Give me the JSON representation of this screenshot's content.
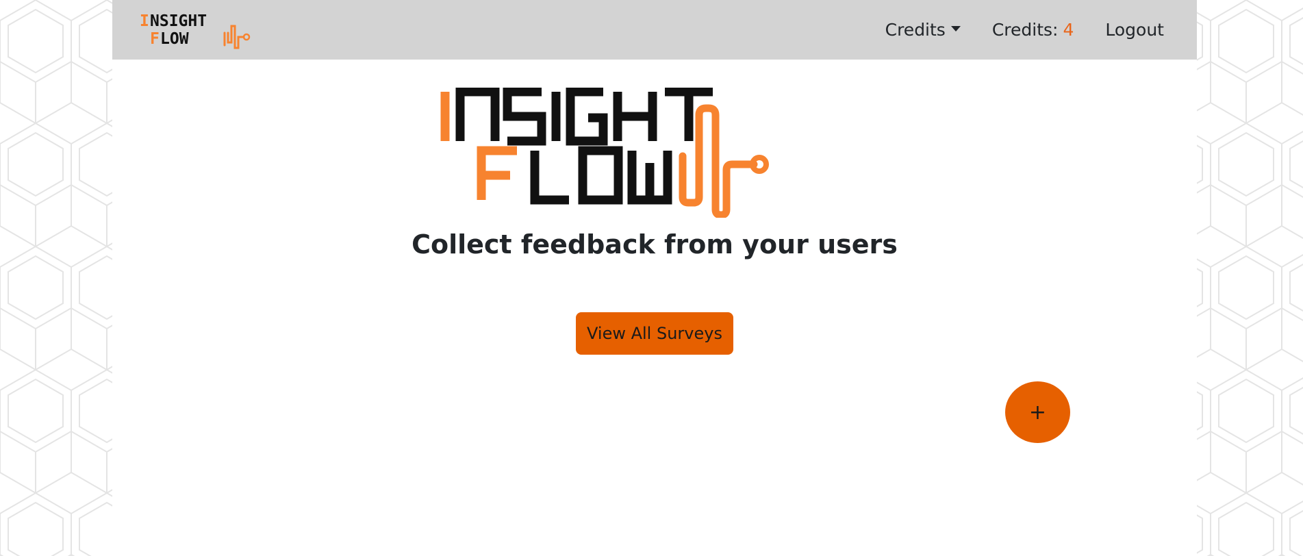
{
  "brand": {
    "name": "InsightFlow",
    "accent_color": "#e66000",
    "logo_orange": "#f7832f"
  },
  "nav": {
    "dropdown_label": "Credits",
    "credits_label": "Credits:",
    "credits_value": "4",
    "logout_label": "Logout"
  },
  "hero": {
    "tagline": "Collect feedback from your users",
    "view_all_label": "View All Surveys"
  },
  "fab": {
    "label": "+"
  }
}
